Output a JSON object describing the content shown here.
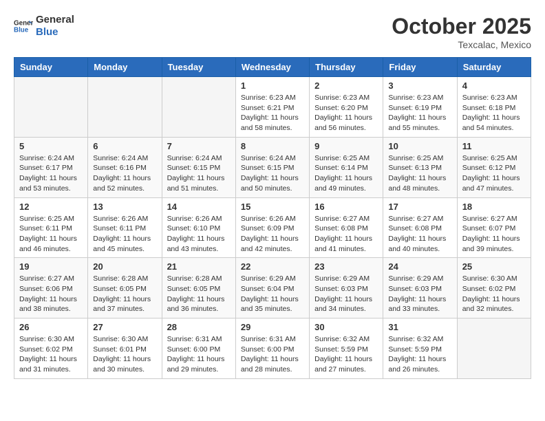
{
  "header": {
    "logo_line1": "General",
    "logo_line2": "Blue",
    "month": "October 2025",
    "location": "Texcalac, Mexico"
  },
  "days_of_week": [
    "Sunday",
    "Monday",
    "Tuesday",
    "Wednesday",
    "Thursday",
    "Friday",
    "Saturday"
  ],
  "weeks": [
    [
      {
        "day": "",
        "info": ""
      },
      {
        "day": "",
        "info": ""
      },
      {
        "day": "",
        "info": ""
      },
      {
        "day": "1",
        "info": "Sunrise: 6:23 AM\nSunset: 6:21 PM\nDaylight: 11 hours and 58 minutes."
      },
      {
        "day": "2",
        "info": "Sunrise: 6:23 AM\nSunset: 6:20 PM\nDaylight: 11 hours and 56 minutes."
      },
      {
        "day": "3",
        "info": "Sunrise: 6:23 AM\nSunset: 6:19 PM\nDaylight: 11 hours and 55 minutes."
      },
      {
        "day": "4",
        "info": "Sunrise: 6:23 AM\nSunset: 6:18 PM\nDaylight: 11 hours and 54 minutes."
      }
    ],
    [
      {
        "day": "5",
        "info": "Sunrise: 6:24 AM\nSunset: 6:17 PM\nDaylight: 11 hours and 53 minutes."
      },
      {
        "day": "6",
        "info": "Sunrise: 6:24 AM\nSunset: 6:16 PM\nDaylight: 11 hours and 52 minutes."
      },
      {
        "day": "7",
        "info": "Sunrise: 6:24 AM\nSunset: 6:15 PM\nDaylight: 11 hours and 51 minutes."
      },
      {
        "day": "8",
        "info": "Sunrise: 6:24 AM\nSunset: 6:15 PM\nDaylight: 11 hours and 50 minutes."
      },
      {
        "day": "9",
        "info": "Sunrise: 6:25 AM\nSunset: 6:14 PM\nDaylight: 11 hours and 49 minutes."
      },
      {
        "day": "10",
        "info": "Sunrise: 6:25 AM\nSunset: 6:13 PM\nDaylight: 11 hours and 48 minutes."
      },
      {
        "day": "11",
        "info": "Sunrise: 6:25 AM\nSunset: 6:12 PM\nDaylight: 11 hours and 47 minutes."
      }
    ],
    [
      {
        "day": "12",
        "info": "Sunrise: 6:25 AM\nSunset: 6:11 PM\nDaylight: 11 hours and 46 minutes."
      },
      {
        "day": "13",
        "info": "Sunrise: 6:26 AM\nSunset: 6:11 PM\nDaylight: 11 hours and 45 minutes."
      },
      {
        "day": "14",
        "info": "Sunrise: 6:26 AM\nSunset: 6:10 PM\nDaylight: 11 hours and 43 minutes."
      },
      {
        "day": "15",
        "info": "Sunrise: 6:26 AM\nSunset: 6:09 PM\nDaylight: 11 hours and 42 minutes."
      },
      {
        "day": "16",
        "info": "Sunrise: 6:27 AM\nSunset: 6:08 PM\nDaylight: 11 hours and 41 minutes."
      },
      {
        "day": "17",
        "info": "Sunrise: 6:27 AM\nSunset: 6:08 PM\nDaylight: 11 hours and 40 minutes."
      },
      {
        "day": "18",
        "info": "Sunrise: 6:27 AM\nSunset: 6:07 PM\nDaylight: 11 hours and 39 minutes."
      }
    ],
    [
      {
        "day": "19",
        "info": "Sunrise: 6:27 AM\nSunset: 6:06 PM\nDaylight: 11 hours and 38 minutes."
      },
      {
        "day": "20",
        "info": "Sunrise: 6:28 AM\nSunset: 6:05 PM\nDaylight: 11 hours and 37 minutes."
      },
      {
        "day": "21",
        "info": "Sunrise: 6:28 AM\nSunset: 6:05 PM\nDaylight: 11 hours and 36 minutes."
      },
      {
        "day": "22",
        "info": "Sunrise: 6:29 AM\nSunset: 6:04 PM\nDaylight: 11 hours and 35 minutes."
      },
      {
        "day": "23",
        "info": "Sunrise: 6:29 AM\nSunset: 6:03 PM\nDaylight: 11 hours and 34 minutes."
      },
      {
        "day": "24",
        "info": "Sunrise: 6:29 AM\nSunset: 6:03 PM\nDaylight: 11 hours and 33 minutes."
      },
      {
        "day": "25",
        "info": "Sunrise: 6:30 AM\nSunset: 6:02 PM\nDaylight: 11 hours and 32 minutes."
      }
    ],
    [
      {
        "day": "26",
        "info": "Sunrise: 6:30 AM\nSunset: 6:02 PM\nDaylight: 11 hours and 31 minutes."
      },
      {
        "day": "27",
        "info": "Sunrise: 6:30 AM\nSunset: 6:01 PM\nDaylight: 11 hours and 30 minutes."
      },
      {
        "day": "28",
        "info": "Sunrise: 6:31 AM\nSunset: 6:00 PM\nDaylight: 11 hours and 29 minutes."
      },
      {
        "day": "29",
        "info": "Sunrise: 6:31 AM\nSunset: 6:00 PM\nDaylight: 11 hours and 28 minutes."
      },
      {
        "day": "30",
        "info": "Sunrise: 6:32 AM\nSunset: 5:59 PM\nDaylight: 11 hours and 27 minutes."
      },
      {
        "day": "31",
        "info": "Sunrise: 6:32 AM\nSunset: 5:59 PM\nDaylight: 11 hours and 26 minutes."
      },
      {
        "day": "",
        "info": ""
      }
    ]
  ]
}
